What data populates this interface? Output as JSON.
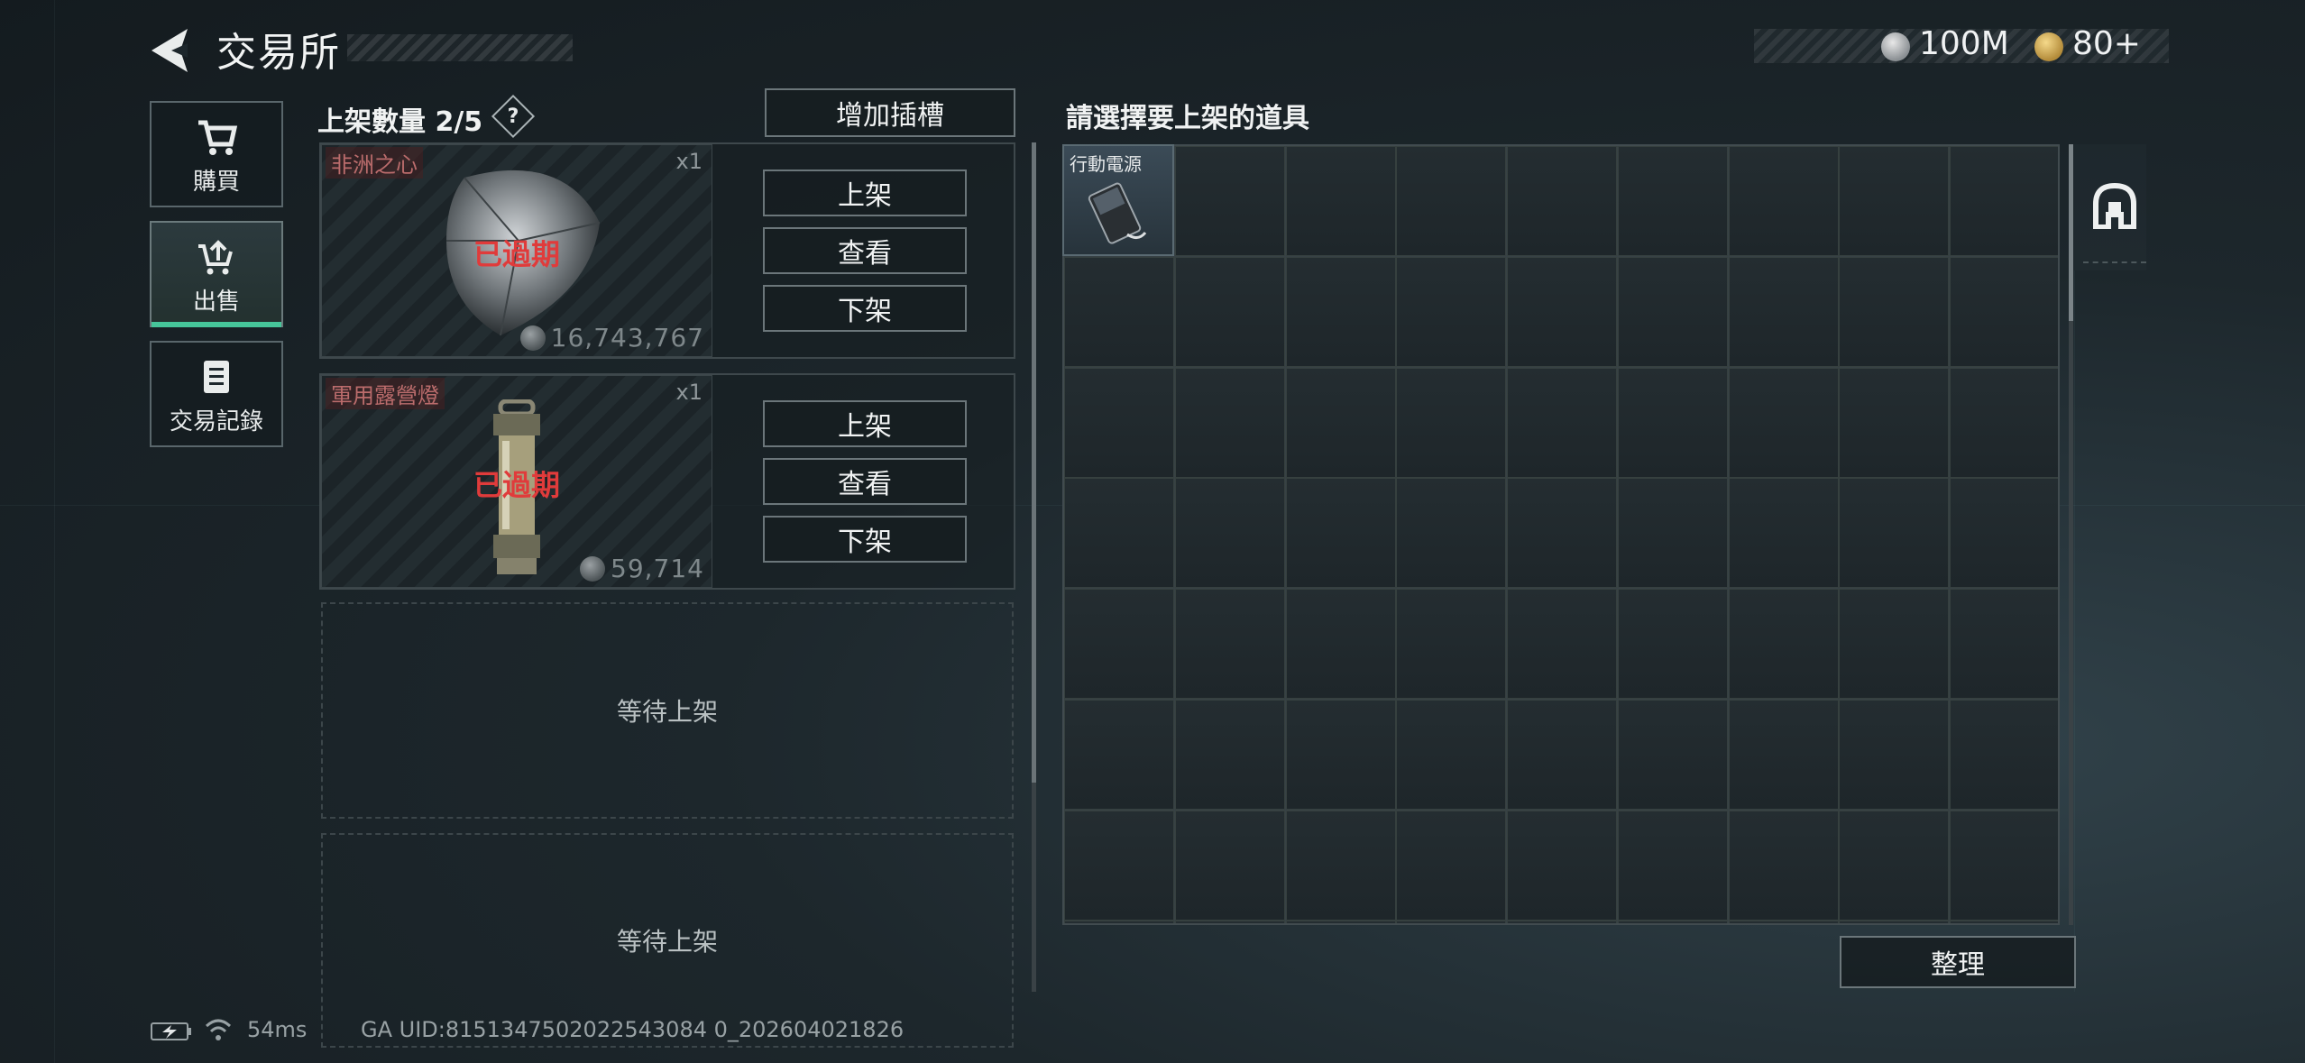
{
  "header": {
    "title": "交易所",
    "currency": [
      {
        "icon": "silver-coin-icon",
        "amount": "100M"
      },
      {
        "icon": "gold-coin-icon",
        "amount": "80+"
      }
    ]
  },
  "sidebar": {
    "items": [
      {
        "label": "購買",
        "icon": "cart-icon",
        "active": false
      },
      {
        "label": "出售",
        "icon": "sell-icon",
        "active": true
      },
      {
        "label": "交易記錄",
        "icon": "record-icon",
        "active": false
      }
    ]
  },
  "listings": {
    "count_label": "上架數量 2/5",
    "help_symbol": "?",
    "add_slot_label": "增加插槽",
    "items": [
      {
        "name": "非洲之心",
        "qty": "x1",
        "status": "已過期",
        "price": "16,743,767",
        "actions": [
          "上架",
          "查看",
          "下架"
        ]
      },
      {
        "name": "軍用露營燈",
        "qty": "x1",
        "status": "已過期",
        "price": "59,714",
        "actions": [
          "上架",
          "查看",
          "下架"
        ]
      }
    ],
    "empty_slots": [
      "等待上架",
      "等待上架"
    ]
  },
  "inventory": {
    "title": "請選擇要上架的道具",
    "items": [
      {
        "name": "行動電源"
      }
    ],
    "sort_label": "整理"
  },
  "status_bar": {
    "ping": "54ms",
    "uid": "GA UID:8151347502022543084 0_202604021826"
  },
  "colors": {
    "accent": "#46c69a",
    "expired": "#e03b3b",
    "item_name_red": "#bb6c6c"
  }
}
